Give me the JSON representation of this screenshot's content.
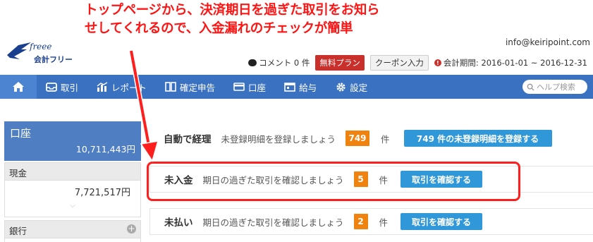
{
  "annotation": {
    "line1": "トップページから、決済期日を過ぎた取引をお知ら",
    "line2": "せしてくれるので、入金漏れのチェックが簡単"
  },
  "header": {
    "brand": "freee",
    "brand_sub": "会計フリー",
    "email": "info@keiripoint.com",
    "comment": "コメント 0 件",
    "free_plan": "無料プラン",
    "coupon": "クーポン入力",
    "period": "会計期間: 2016-01-01 ~ 2016-12-31"
  },
  "nav": {
    "items": [
      {
        "label": "取引"
      },
      {
        "label": "レポート"
      },
      {
        "label": "確定申告"
      },
      {
        "label": "口座"
      },
      {
        "label": "給与"
      },
      {
        "label": "設定"
      }
    ],
    "help_placeholder": "ヘルプ検索"
  },
  "sidebar": {
    "accounts_title": "口座",
    "accounts_total": "10,711,443円",
    "cash_label": "現金",
    "cash_value": "7,721,517円",
    "bank_label": "銀行"
  },
  "rows": {
    "auto": {
      "label": "自動で経理",
      "message": "未登録明細を登録しましょう",
      "count": "749",
      "unit": "件",
      "action": "749 件の未登録明細を登録する"
    },
    "receivable": {
      "label": "未入金",
      "message": "期日の過ぎた取引を確認しましょう",
      "count": "5",
      "unit": "件",
      "action": "取引を確認する"
    },
    "payable": {
      "label": "未払い",
      "message": "期日の過ぎた取引を確認しましょう",
      "count": "2",
      "unit": "件",
      "action": "取引を確認する"
    }
  },
  "colors": {
    "nav_bg": "#3a71c0",
    "accent": "#3098d8",
    "badge": "#f0820f",
    "annotation": "#ff1414"
  }
}
